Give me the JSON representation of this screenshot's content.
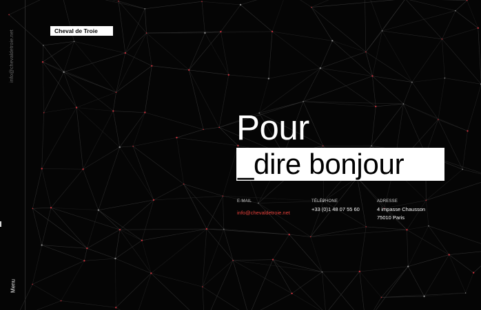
{
  "brand": {
    "logo_text": "Cheval de Troie"
  },
  "sidebar": {
    "email": "info@chevaldetroie.net",
    "menu_label": "Menu"
  },
  "hero": {
    "line1": "Pour",
    "line2": "_dire bonjour"
  },
  "contact": {
    "email": {
      "label": "E-MAIL",
      "value": "info@chevaldetroie.net"
    },
    "phone": {
      "label": "TÉLÉPHONE",
      "value": "+33 (0)1 48 07 55 60"
    },
    "address": {
      "label": "ADRESSE",
      "line1": "4 impasse Chausson",
      "line2": "75010 Paris"
    }
  },
  "colors": {
    "background": "#050505",
    "accent": "#e5403a",
    "network_line": "#3a3a3a",
    "network_node": "#c0303a"
  }
}
